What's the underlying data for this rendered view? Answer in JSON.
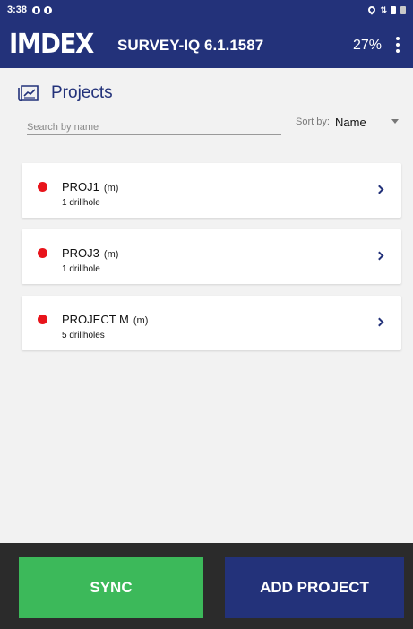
{
  "status_bar": {
    "time": "3:38"
  },
  "app_bar": {
    "logo": "IMDEX",
    "title": "SURVEY-IQ 6.1.1587",
    "battery": "27%"
  },
  "page": {
    "title": "Projects",
    "search_placeholder": "Search by name",
    "sort_label": "Sort by:",
    "sort_value": "Name"
  },
  "projects": [
    {
      "name": "PROJ1",
      "unit": "(m)",
      "count": "1 drillhole",
      "status_color": "#e8141b"
    },
    {
      "name": "PROJ3",
      "unit": "(m)",
      "count": "1 drillhole",
      "status_color": "#e8141b"
    },
    {
      "name": "PROJECT M",
      "unit": "(m)",
      "count": "5 drillholes",
      "status_color": "#e8141b"
    }
  ],
  "actions": {
    "sync": "SYNC",
    "add_project": "ADD PROJECT"
  },
  "colors": {
    "brand": "#23327a",
    "sync": "#3cb95a",
    "status_dot": "#e8141b"
  }
}
